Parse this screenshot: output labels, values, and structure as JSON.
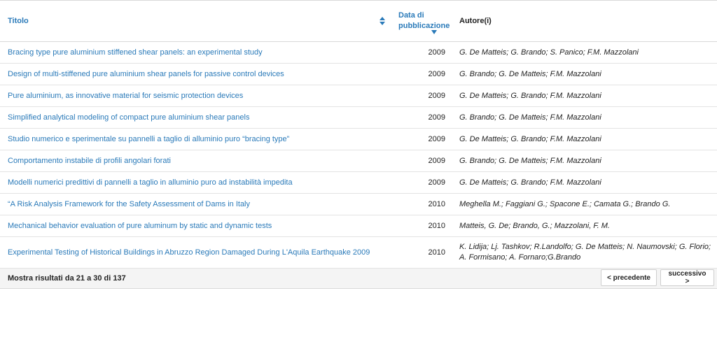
{
  "table": {
    "headers": {
      "title": "Titolo",
      "date": "Data di pubblicazione",
      "authors": "Autore(i)"
    },
    "rows": [
      {
        "title": "Bracing type pure aluminium stiffened shear panels: an experimental study",
        "year": "2009",
        "authors": "G. De Matteis; G. Brando; S. Panico; F.M. Mazzolani"
      },
      {
        "title": "Design of multi-stiffened pure aluminium shear panels for passive control devices",
        "year": "2009",
        "authors": "G. Brando; G. De Matteis; F.M. Mazzolani"
      },
      {
        "title": "Pure aluminium, as innovative material for seismic protection devices",
        "year": "2009",
        "authors": "G. De Matteis; G. Brando; F.M. Mazzolani"
      },
      {
        "title": "Simplified analytical modeling of compact pure aluminium shear panels",
        "year": "2009",
        "authors": "G. Brando; G. De Matteis; F.M. Mazzolani"
      },
      {
        "title": "Studio numerico e sperimentale su pannelli a taglio di alluminio puro “bracing type”",
        "year": "2009",
        "authors": "G. De Matteis; G. Brando; F.M. Mazzolani"
      },
      {
        "title": "Comportamento instabile di profili angolari forati",
        "year": "2009",
        "authors": "G. Brando; G. De Matteis; F.M. Mazzolani"
      },
      {
        "title": "Modelli numerici predittivi di pannelli a taglio in alluminio puro ad instabilità impedita",
        "year": "2009",
        "authors": "G. De Matteis; G. Brando; F.M. Mazzolani"
      },
      {
        "title": "“A Risk Analysis Framework for the Safety Assessment of Dams in Italy",
        "year": "2010",
        "authors": "Meghella M.; Faggiani G.; Spacone E.; Camata G.; Brando G."
      },
      {
        "title": "Mechanical behavior evaluation of pure aluminum by static and dynamic tests",
        "year": "2010",
        "authors": "Matteis, G. De; Brando, G.; Mazzolani, F. M."
      },
      {
        "title": "Experimental Testing of Historical Buildings in Abruzzo Region Damaged During L'Aquila Earthquake 2009",
        "year": "2010",
        "authors": "K. Lidija; Lj. Tashkov; R.Landolfo; G. De Matteis; N. Naumovski; G. Florio; A. Formisano; A. Fornaro;G.Brando"
      }
    ]
  },
  "footer": {
    "results_text": "Mostra risultati da 21 a 30 di 137",
    "prev_label": "< precedente",
    "next_label": "successivo >"
  },
  "colors": {
    "link": "#2a7ab9",
    "footer_bg": "#f4f4f4"
  },
  "icons": {
    "title_sort": "sort-up-down-icon",
    "date_sort": "sort-descending-icon"
  }
}
